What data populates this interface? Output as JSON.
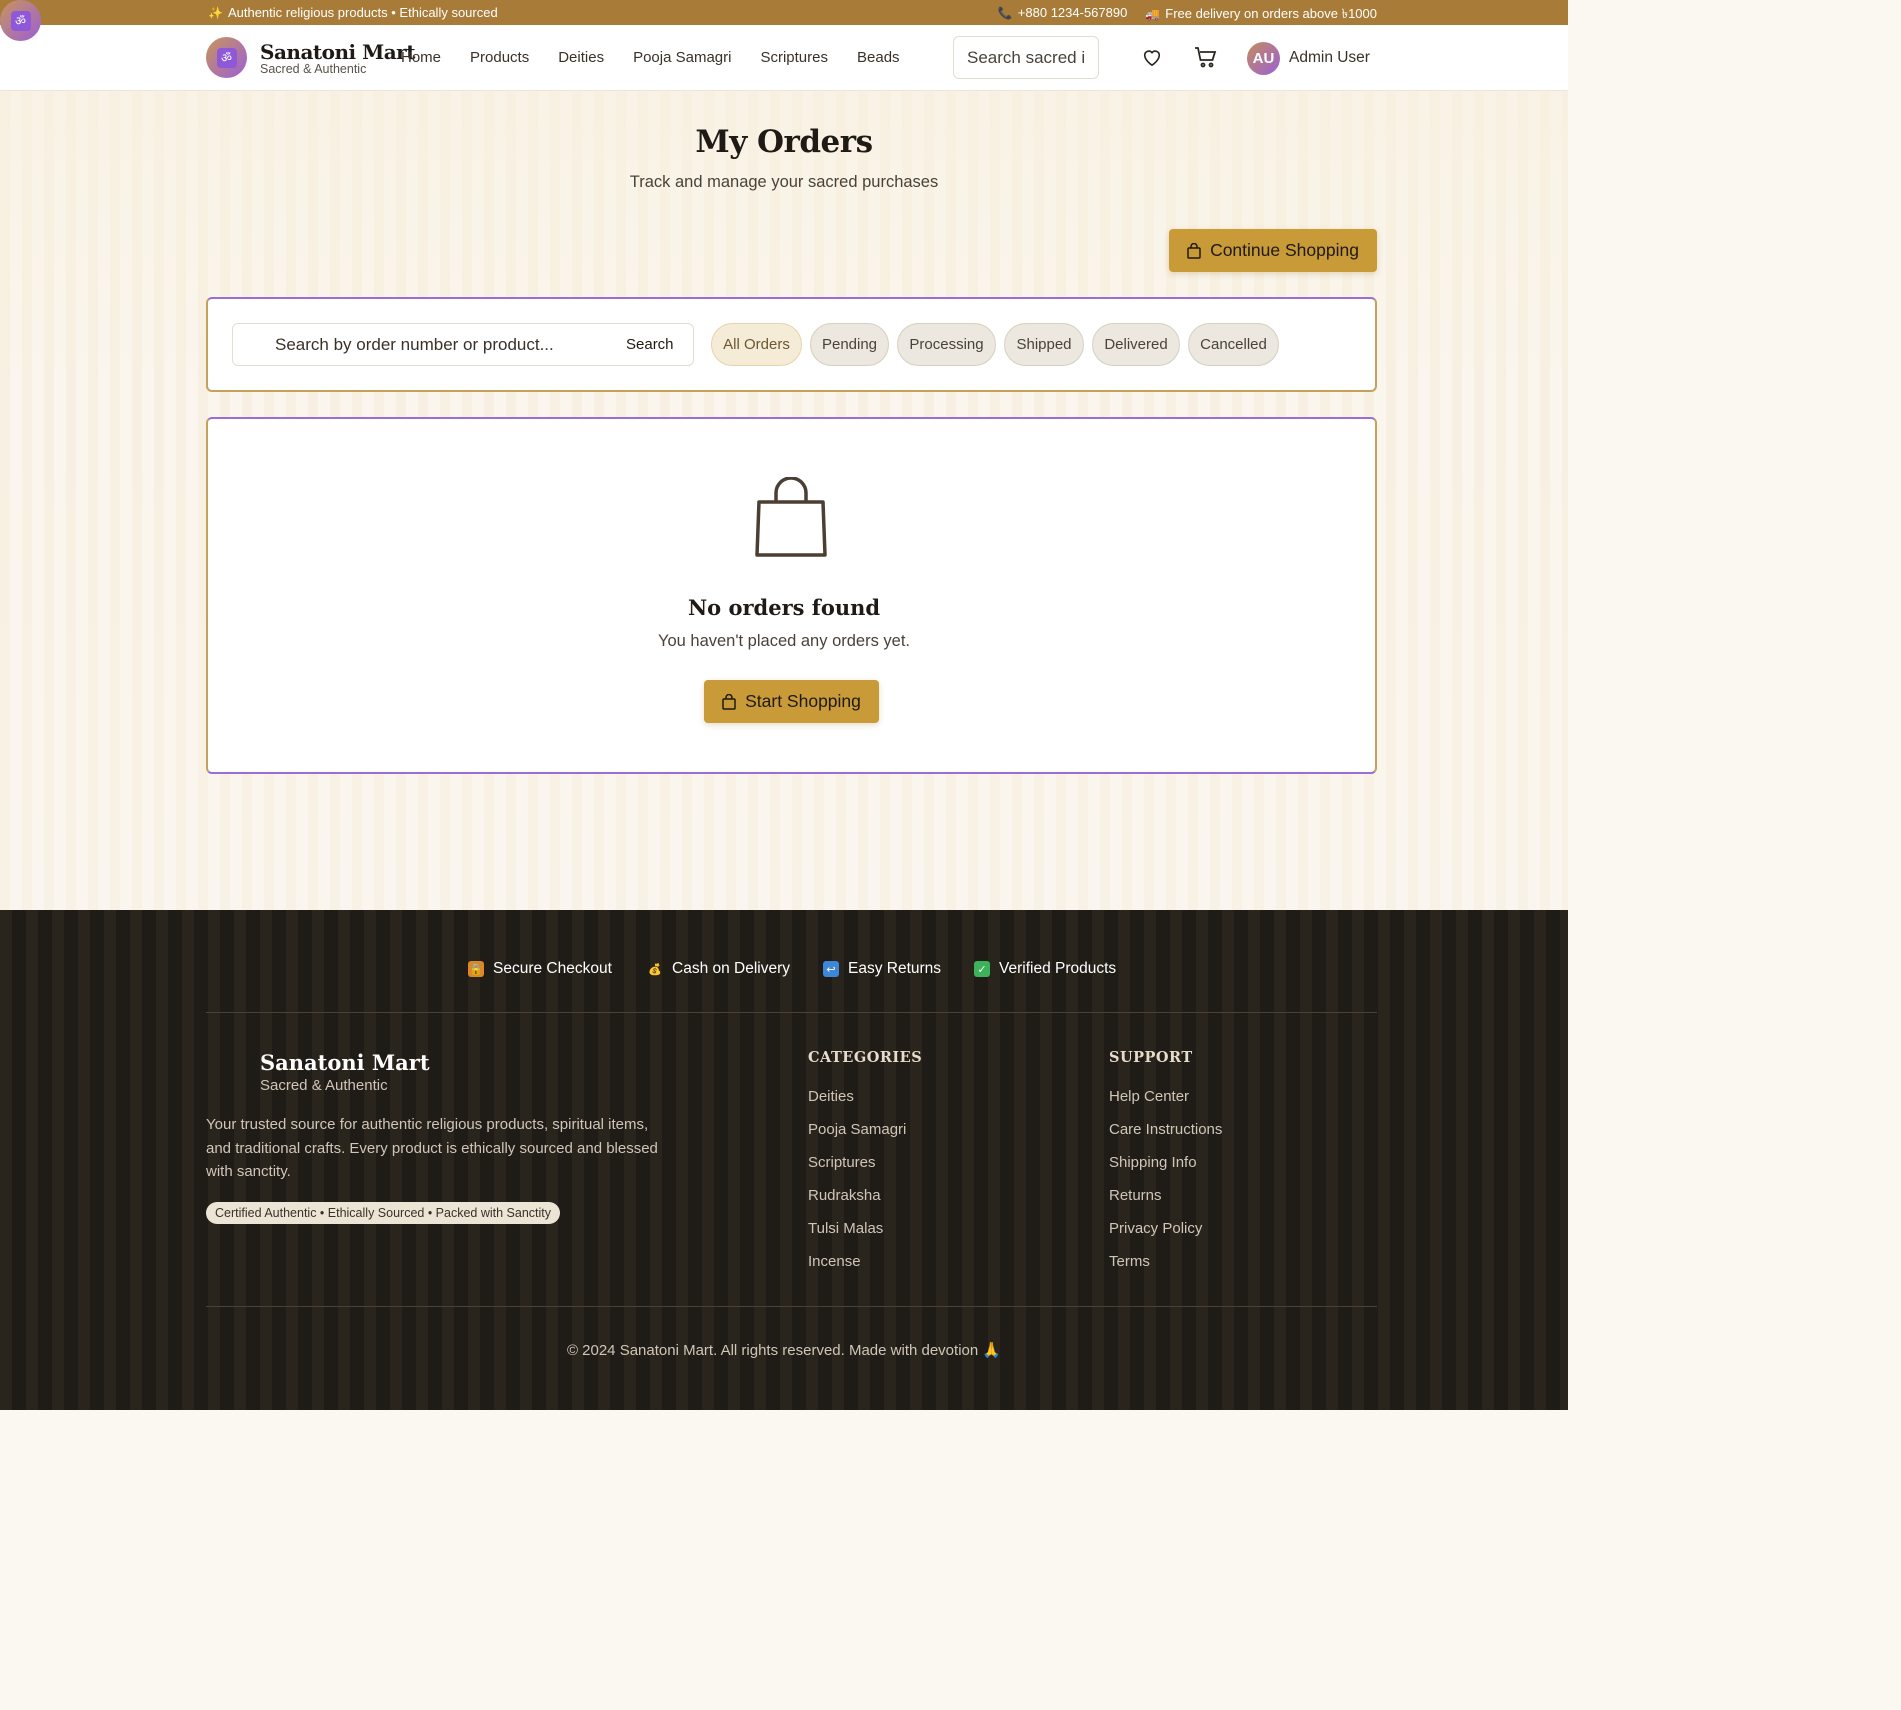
{
  "topbar": {
    "left_text": "Authentic religious products • Ethically sourced",
    "phone": "+880 1234-567890",
    "delivery": "Free delivery on orders above ৳1000"
  },
  "header": {
    "brand_name": "Sanatoni Mart",
    "brand_tagline": "Sacred & Authentic",
    "logo_glyph": "ॐ",
    "nav": [
      "Home",
      "Products",
      "Deities",
      "Pooja Samagri",
      "Scriptures",
      "Beads"
    ],
    "search_placeholder": "Search sacred items...",
    "avatar_initials": "AU",
    "user_name": "Admin User"
  },
  "main": {
    "title": "My Orders",
    "subtitle": "Track and manage your sacred purchases",
    "continue_label": "Continue Shopping",
    "order_search_placeholder": "Search by order number or product...",
    "search_button": "Search",
    "filters": [
      "All Orders",
      "Pending",
      "Processing",
      "Shipped",
      "Delivered",
      "Cancelled"
    ],
    "active_filter": "All Orders",
    "empty_title": "No orders found",
    "empty_sub": "You haven't placed any orders yet.",
    "start_label": "Start Shopping"
  },
  "footer": {
    "trust": [
      {
        "label": "Secure Checkout",
        "icon": "lock-icon"
      },
      {
        "label": "Cash on Delivery",
        "icon": "money-bag-icon"
      },
      {
        "label": "Easy Returns",
        "icon": "return-icon"
      },
      {
        "label": "Verified Products",
        "icon": "check-icon"
      }
    ],
    "brand_name": "Sanatoni Mart",
    "brand_tagline": "Sacred & Authentic",
    "description": "Your trusted source for authentic religious products, spiritual items, and traditional crafts. Every product is ethically sourced and blessed with sanctity.",
    "badge": "Certified Authentic • Ethically Sourced • Packed with Sanctity",
    "categories_title": "CATEGORIES",
    "categories": [
      "Deities",
      "Pooja Samagri",
      "Scriptures",
      "Rudraksha",
      "Tulsi Malas",
      "Incense"
    ],
    "support_title": "SUPPORT",
    "support": [
      "Help Center",
      "Care Instructions",
      "Shipping Info",
      "Returns",
      "Privacy Policy",
      "Terms"
    ],
    "copyright": "© 2024 Sanatoni Mart. All rights reserved. Made with devotion 🙏"
  },
  "colors": {
    "topbar": "#a87c38",
    "accent_gold": "#c89a38",
    "accent_purple": "#9b6dd6",
    "footer_bg": "#1f1b16"
  }
}
